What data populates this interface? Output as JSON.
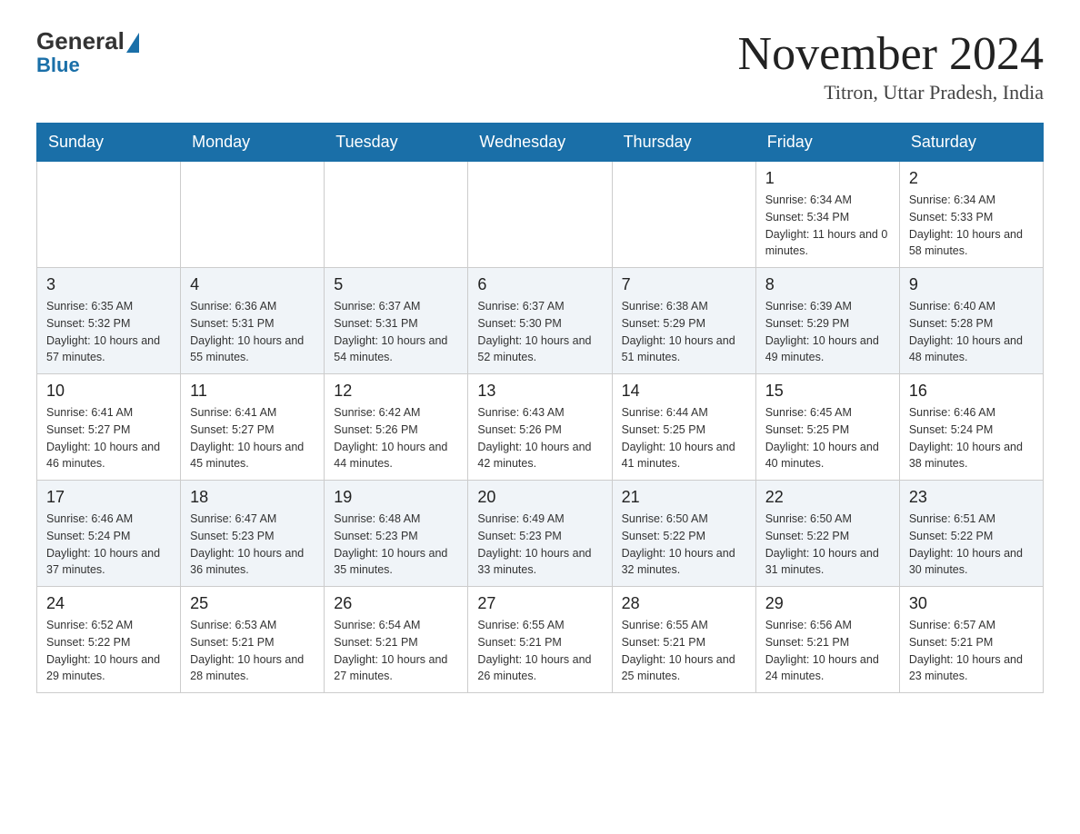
{
  "header": {
    "logo_general": "General",
    "logo_blue": "Blue",
    "month_title": "November 2024",
    "location": "Titron, Uttar Pradesh, India"
  },
  "weekdays": [
    "Sunday",
    "Monday",
    "Tuesday",
    "Wednesday",
    "Thursday",
    "Friday",
    "Saturday"
  ],
  "weeks": [
    {
      "days": [
        {
          "num": "",
          "info": ""
        },
        {
          "num": "",
          "info": ""
        },
        {
          "num": "",
          "info": ""
        },
        {
          "num": "",
          "info": ""
        },
        {
          "num": "",
          "info": ""
        },
        {
          "num": "1",
          "info": "Sunrise: 6:34 AM\nSunset: 5:34 PM\nDaylight: 11 hours and 0 minutes."
        },
        {
          "num": "2",
          "info": "Sunrise: 6:34 AM\nSunset: 5:33 PM\nDaylight: 10 hours and 58 minutes."
        }
      ]
    },
    {
      "days": [
        {
          "num": "3",
          "info": "Sunrise: 6:35 AM\nSunset: 5:32 PM\nDaylight: 10 hours and 57 minutes."
        },
        {
          "num": "4",
          "info": "Sunrise: 6:36 AM\nSunset: 5:31 PM\nDaylight: 10 hours and 55 minutes."
        },
        {
          "num": "5",
          "info": "Sunrise: 6:37 AM\nSunset: 5:31 PM\nDaylight: 10 hours and 54 minutes."
        },
        {
          "num": "6",
          "info": "Sunrise: 6:37 AM\nSunset: 5:30 PM\nDaylight: 10 hours and 52 minutes."
        },
        {
          "num": "7",
          "info": "Sunrise: 6:38 AM\nSunset: 5:29 PM\nDaylight: 10 hours and 51 minutes."
        },
        {
          "num": "8",
          "info": "Sunrise: 6:39 AM\nSunset: 5:29 PM\nDaylight: 10 hours and 49 minutes."
        },
        {
          "num": "9",
          "info": "Sunrise: 6:40 AM\nSunset: 5:28 PM\nDaylight: 10 hours and 48 minutes."
        }
      ]
    },
    {
      "days": [
        {
          "num": "10",
          "info": "Sunrise: 6:41 AM\nSunset: 5:27 PM\nDaylight: 10 hours and 46 minutes."
        },
        {
          "num": "11",
          "info": "Sunrise: 6:41 AM\nSunset: 5:27 PM\nDaylight: 10 hours and 45 minutes."
        },
        {
          "num": "12",
          "info": "Sunrise: 6:42 AM\nSunset: 5:26 PM\nDaylight: 10 hours and 44 minutes."
        },
        {
          "num": "13",
          "info": "Sunrise: 6:43 AM\nSunset: 5:26 PM\nDaylight: 10 hours and 42 minutes."
        },
        {
          "num": "14",
          "info": "Sunrise: 6:44 AM\nSunset: 5:25 PM\nDaylight: 10 hours and 41 minutes."
        },
        {
          "num": "15",
          "info": "Sunrise: 6:45 AM\nSunset: 5:25 PM\nDaylight: 10 hours and 40 minutes."
        },
        {
          "num": "16",
          "info": "Sunrise: 6:46 AM\nSunset: 5:24 PM\nDaylight: 10 hours and 38 minutes."
        }
      ]
    },
    {
      "days": [
        {
          "num": "17",
          "info": "Sunrise: 6:46 AM\nSunset: 5:24 PM\nDaylight: 10 hours and 37 minutes."
        },
        {
          "num": "18",
          "info": "Sunrise: 6:47 AM\nSunset: 5:23 PM\nDaylight: 10 hours and 36 minutes."
        },
        {
          "num": "19",
          "info": "Sunrise: 6:48 AM\nSunset: 5:23 PM\nDaylight: 10 hours and 35 minutes."
        },
        {
          "num": "20",
          "info": "Sunrise: 6:49 AM\nSunset: 5:23 PM\nDaylight: 10 hours and 33 minutes."
        },
        {
          "num": "21",
          "info": "Sunrise: 6:50 AM\nSunset: 5:22 PM\nDaylight: 10 hours and 32 minutes."
        },
        {
          "num": "22",
          "info": "Sunrise: 6:50 AM\nSunset: 5:22 PM\nDaylight: 10 hours and 31 minutes."
        },
        {
          "num": "23",
          "info": "Sunrise: 6:51 AM\nSunset: 5:22 PM\nDaylight: 10 hours and 30 minutes."
        }
      ]
    },
    {
      "days": [
        {
          "num": "24",
          "info": "Sunrise: 6:52 AM\nSunset: 5:22 PM\nDaylight: 10 hours and 29 minutes."
        },
        {
          "num": "25",
          "info": "Sunrise: 6:53 AM\nSunset: 5:21 PM\nDaylight: 10 hours and 28 minutes."
        },
        {
          "num": "26",
          "info": "Sunrise: 6:54 AM\nSunset: 5:21 PM\nDaylight: 10 hours and 27 minutes."
        },
        {
          "num": "27",
          "info": "Sunrise: 6:55 AM\nSunset: 5:21 PM\nDaylight: 10 hours and 26 minutes."
        },
        {
          "num": "28",
          "info": "Sunrise: 6:55 AM\nSunset: 5:21 PM\nDaylight: 10 hours and 25 minutes."
        },
        {
          "num": "29",
          "info": "Sunrise: 6:56 AM\nSunset: 5:21 PM\nDaylight: 10 hours and 24 minutes."
        },
        {
          "num": "30",
          "info": "Sunrise: 6:57 AM\nSunset: 5:21 PM\nDaylight: 10 hours and 23 minutes."
        }
      ]
    }
  ]
}
